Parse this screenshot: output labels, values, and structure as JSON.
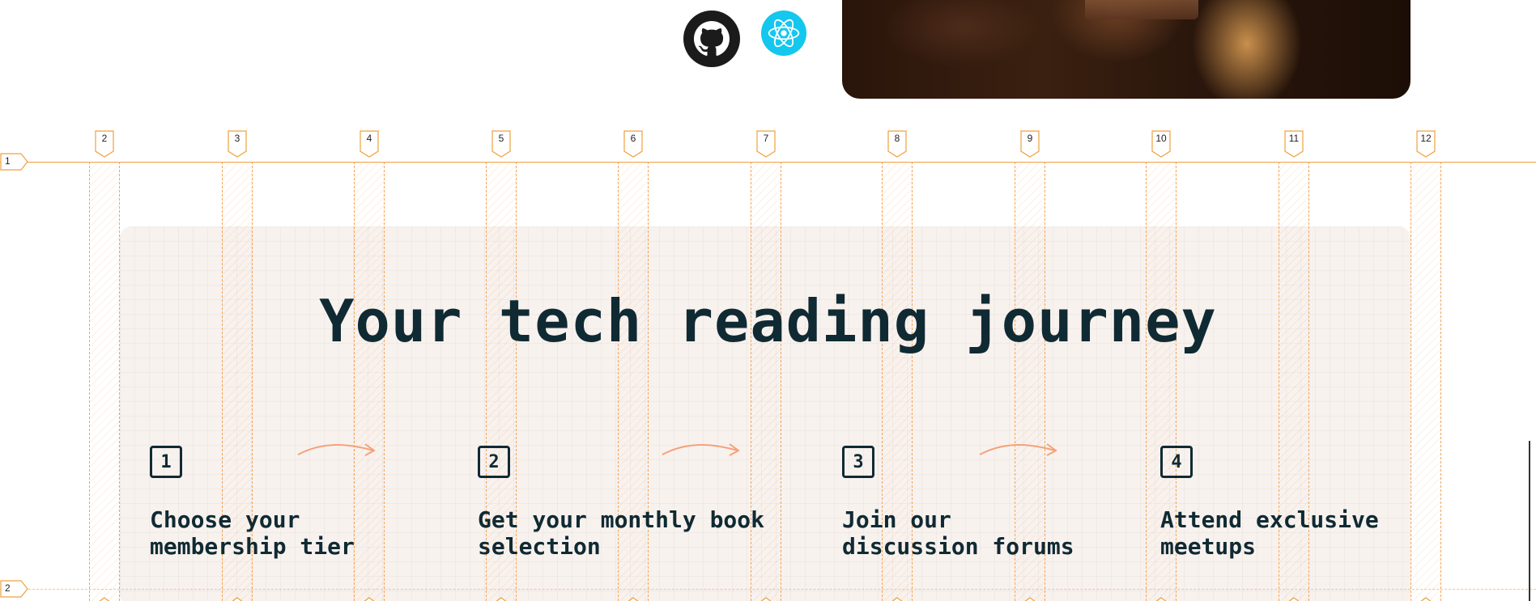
{
  "top": {
    "github_icon": "github-icon",
    "react_icon": "react-icon"
  },
  "grid": {
    "columns": [
      "2",
      "3",
      "4",
      "5",
      "6",
      "7",
      "8",
      "9",
      "10",
      "11",
      "12"
    ],
    "rows": [
      "1",
      "2"
    ],
    "accent": "#f0a040"
  },
  "section": {
    "title": "Your tech reading journey",
    "steps": [
      {
        "number": "1",
        "text_line1": "Choose your",
        "text_line2": "membership tier"
      },
      {
        "number": "2",
        "text_line1": "Get your monthly book",
        "text_line2": "selection"
      },
      {
        "number": "3",
        "text_line1": "Join our",
        "text_line2": "discussion forums"
      },
      {
        "number": "4",
        "text_line1": "Attend exclusive",
        "text_line2": "meetups"
      }
    ]
  },
  "colors": {
    "heading": "#102a33",
    "panel": "#f6eeea",
    "arrow": "#f4a27a",
    "react": "#14c7ee"
  }
}
